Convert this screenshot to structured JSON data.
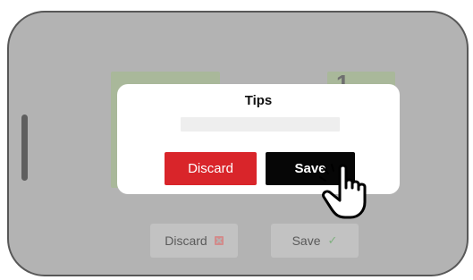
{
  "background": {
    "number_glyph": "1",
    "discard_label": "Discard",
    "discard_icon": "x-box-icon",
    "save_label": "Save",
    "save_icon": "check-icon"
  },
  "dialog": {
    "title": "Tips",
    "input_value": "",
    "discard_label": "Discard",
    "save_label": "Save"
  },
  "colors": {
    "discard": "#d9252a",
    "save": "#060606",
    "overlay": "#b3b3b3"
  },
  "cursor": {
    "icon": "hand-pointer-icon"
  }
}
